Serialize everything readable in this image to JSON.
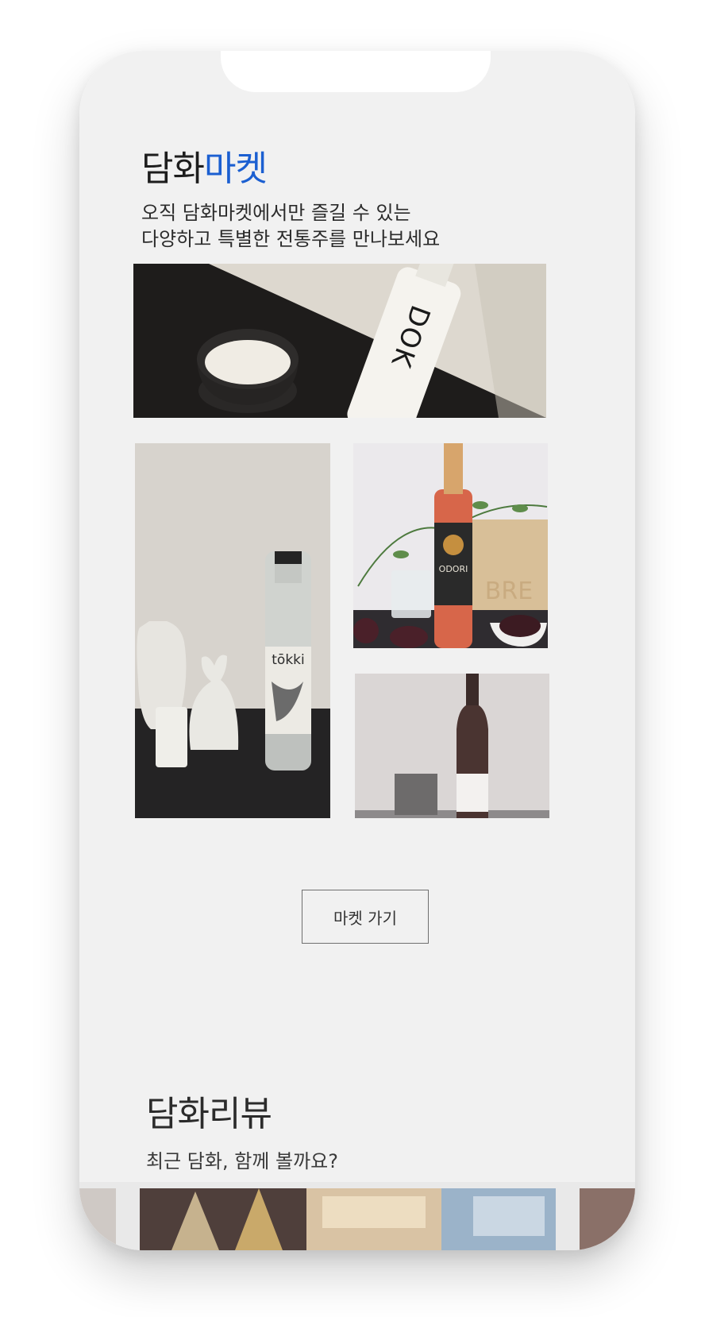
{
  "market": {
    "title_part1": "담화",
    "title_part2": "마켓",
    "subtitle": "오직 담화마켓에서만 즐길 수 있는\n다양하고 특별한 전통주를 만나보세요",
    "button_label": "마켓 가기",
    "accent_color": "#1b5fd1"
  },
  "photos": {
    "dok_label": "DOK",
    "tokki_label": "tōkki",
    "odori_label": "ODORI",
    "bre_label": "BRE"
  },
  "review": {
    "title": "담화리뷰",
    "subtitle": "최근 담화, 함께 볼까요?"
  }
}
